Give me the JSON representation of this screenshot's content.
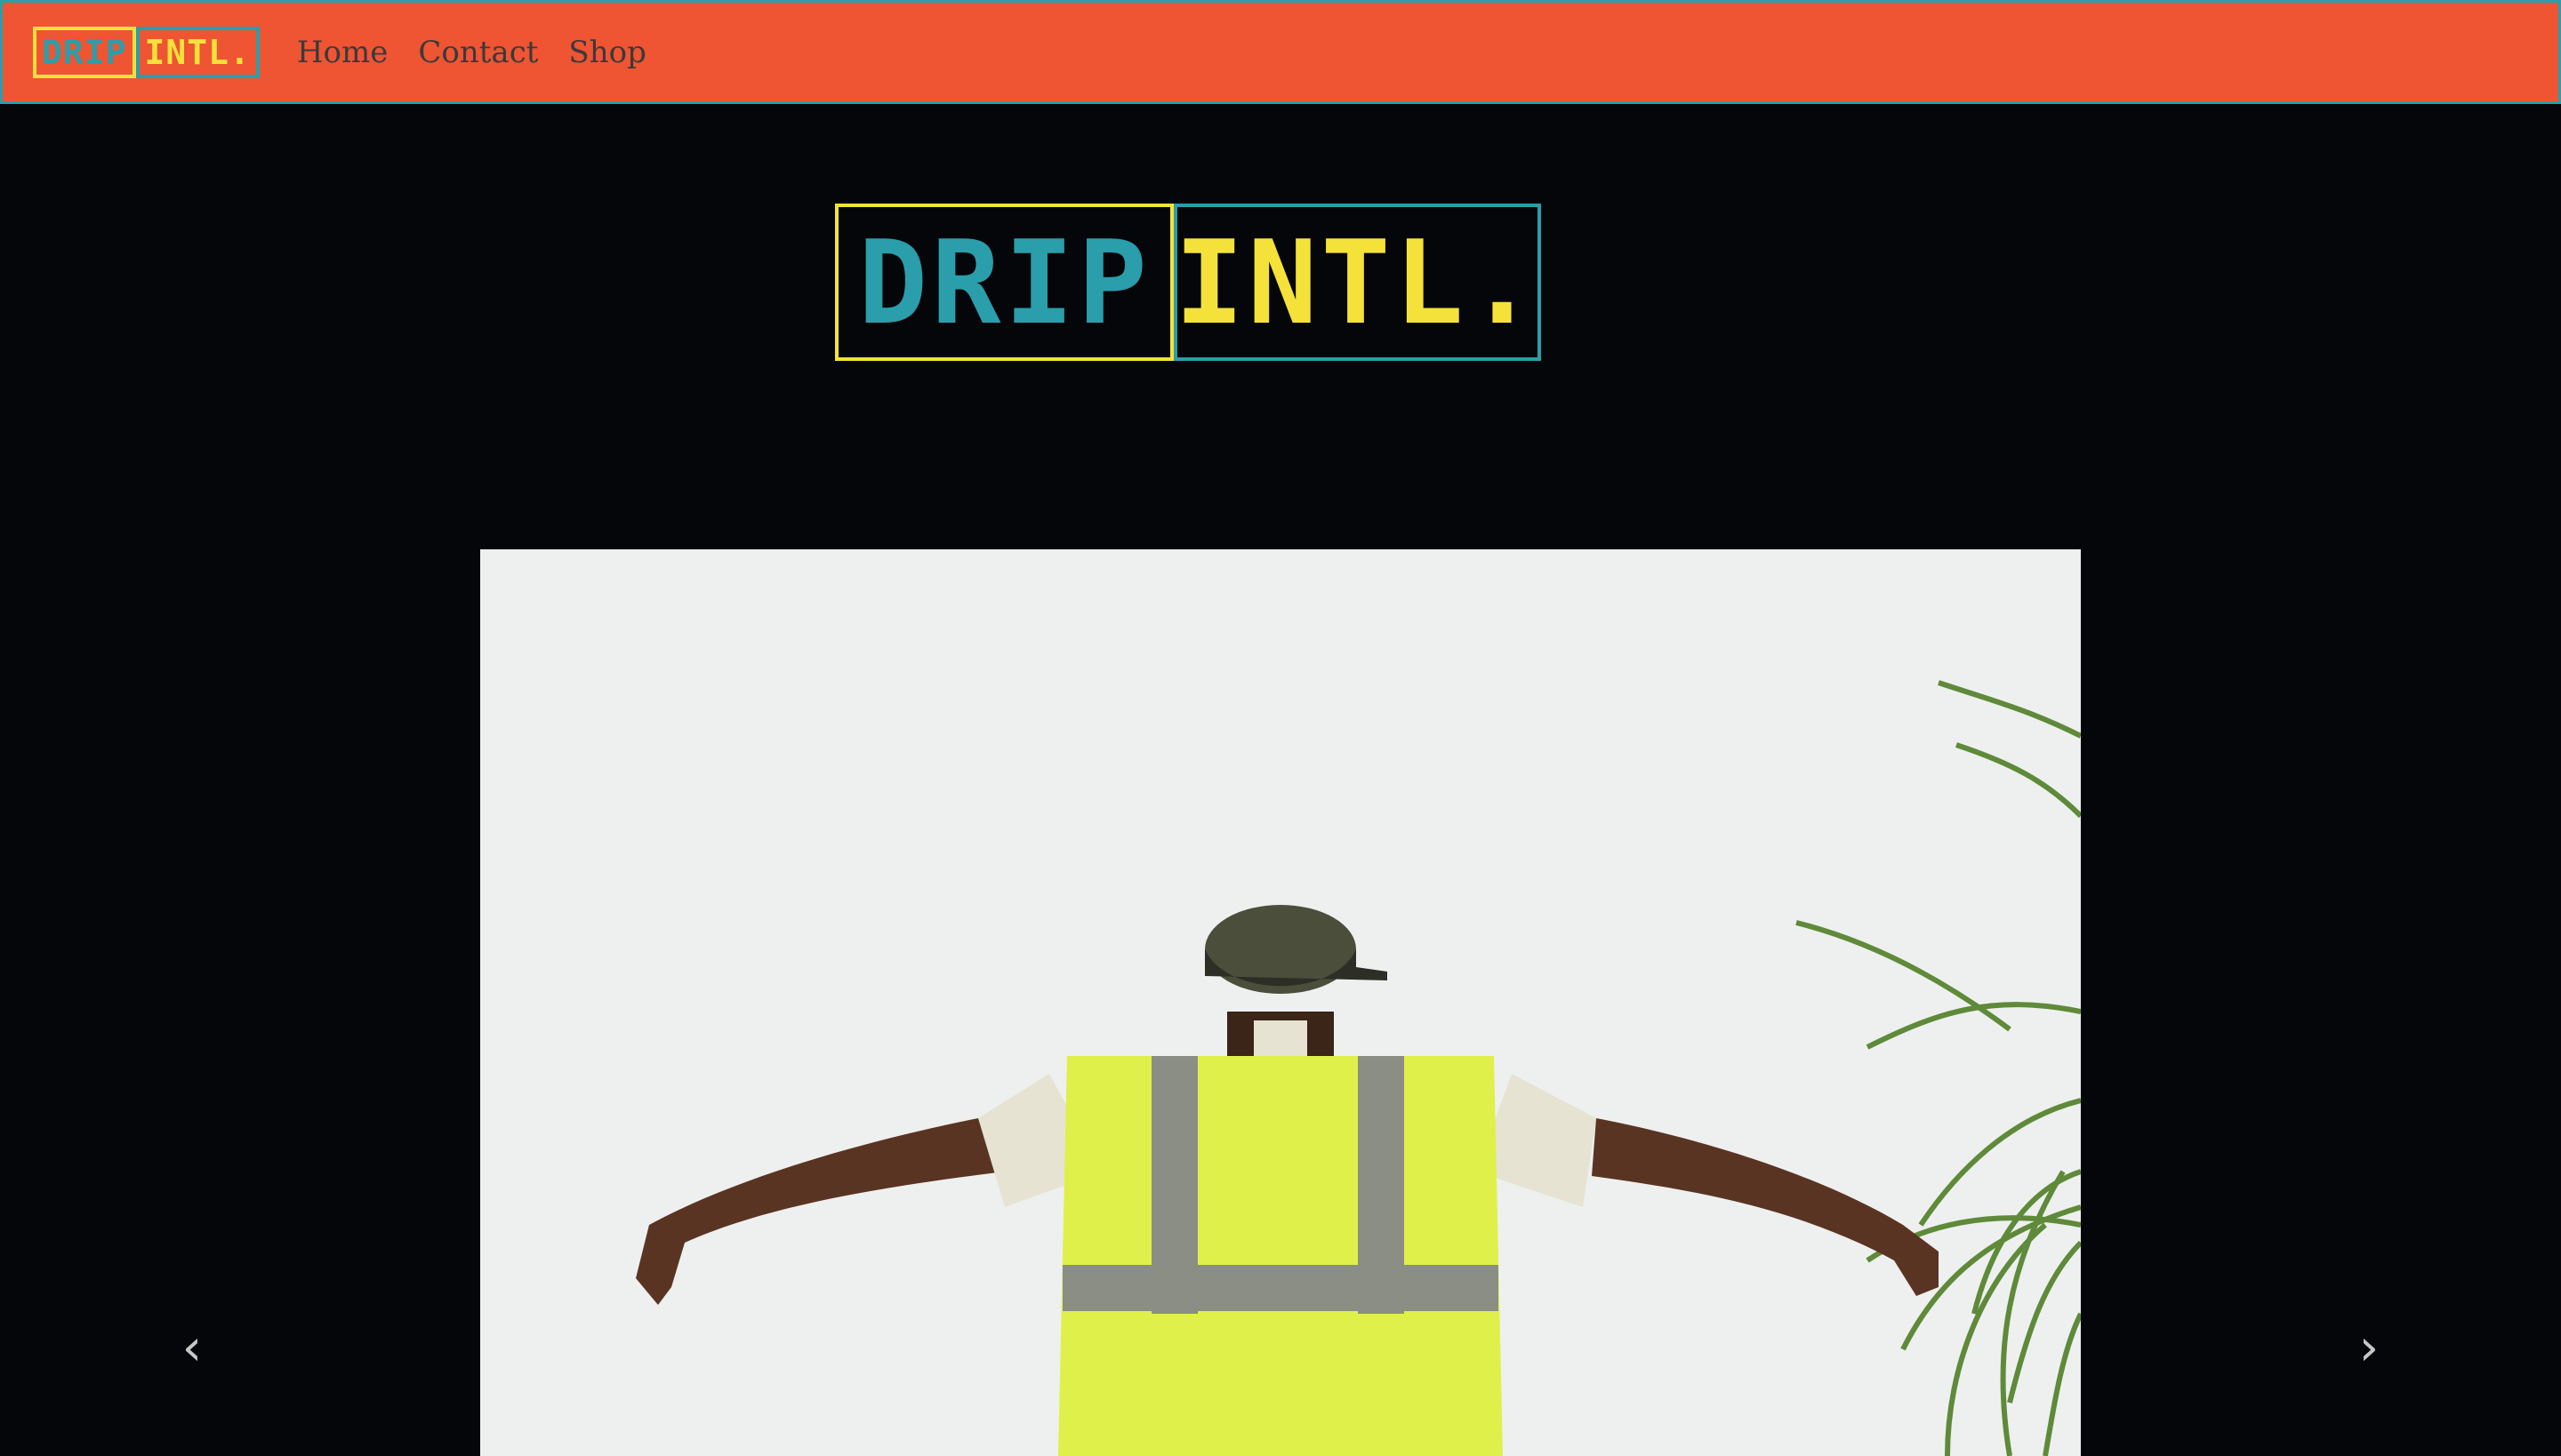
{
  "navbar": {
    "brand": {
      "part1": "DRIP",
      "part2": "INTL."
    },
    "links": [
      {
        "label": "Home"
      },
      {
        "label": "Contact"
      },
      {
        "label": "Shop"
      }
    ]
  },
  "hero": {
    "logo": {
      "part1": "DRIP",
      "part2": "INTL."
    }
  },
  "carousel": {
    "prev_icon": "chevron-left-icon",
    "next_icon": "chevron-right-icon",
    "prev_glyph": "‹",
    "next_glyph": "›"
  },
  "colors": {
    "navbar_bg": "#ef5433",
    "navbar_border": "#2a9eaa",
    "teal": "#2a9eaa",
    "yellow": "#f4e23a",
    "page_bg": "#04060a"
  }
}
